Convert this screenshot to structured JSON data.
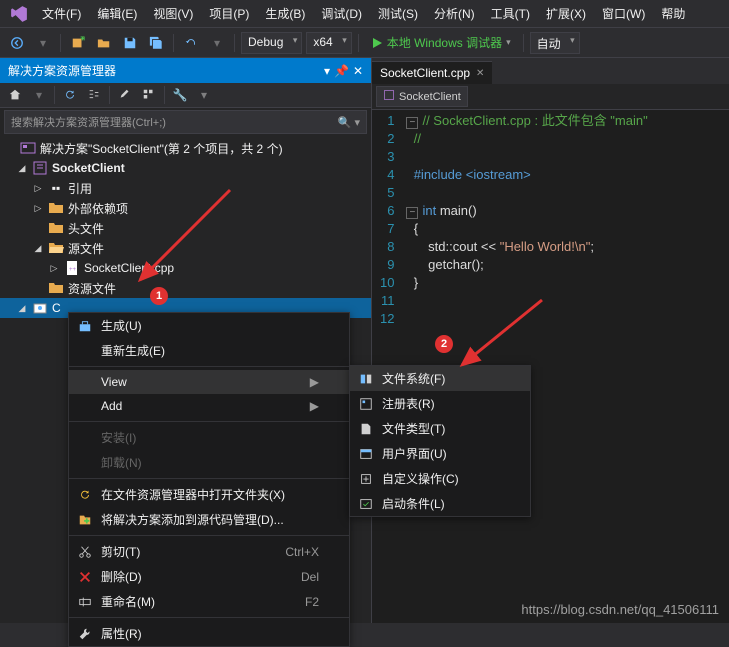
{
  "menubar": {
    "items": [
      "文件(F)",
      "编辑(E)",
      "视图(V)",
      "项目(P)",
      "生成(B)",
      "调试(D)",
      "测试(S)",
      "分析(N)",
      "工具(T)",
      "扩展(X)",
      "窗口(W)",
      "帮助"
    ]
  },
  "toolbar": {
    "config": "Debug",
    "platform": "x64",
    "run_label": "本地 Windows 调试器",
    "auto": "自动"
  },
  "solution_explorer": {
    "title": "解决方案资源管理器",
    "search_placeholder": "搜索解决方案资源管理器(Ctrl+;)",
    "solution_label": "解决方案\"SocketClient\"(第 2 个项目，共 2 个)",
    "project": "SocketClient",
    "nodes": {
      "references": "引用",
      "external": "外部依赖项",
      "headers": "头文件",
      "sources": "源文件",
      "source_file": "SocketClient.cpp",
      "resources": "资源文件"
    },
    "second_project_prefix": "C"
  },
  "editor": {
    "tab": "SocketClient.cpp",
    "nav": "SocketClient",
    "lines": {
      "l1": "// SocketClient.cpp : 此文件包含 \"main\"",
      "l2": "//",
      "l4": "#include <iostream>",
      "l6a": "int",
      "l6b": " main()",
      "l7": "{",
      "l8a": "    std::cout << ",
      "l8b": "\"Hello World!\\n\"",
      "l8c": ";",
      "l9": "    getchar();",
      "l10": "}"
    }
  },
  "context_menu": {
    "items": [
      {
        "icon": "build",
        "label": "生成(U)",
        "type": "item"
      },
      {
        "label": "重新生成(E)",
        "type": "item"
      },
      {
        "type": "sep"
      },
      {
        "label": "View",
        "type": "sub",
        "highlight": true
      },
      {
        "label": "Add",
        "type": "sub"
      },
      {
        "type": "sep"
      },
      {
        "label": "安装(I)",
        "type": "item",
        "disabled": true
      },
      {
        "label": "卸载(N)",
        "type": "item",
        "disabled": true
      },
      {
        "type": "sep"
      },
      {
        "icon": "refresh",
        "label": "在文件资源管理器中打开文件夹(X)",
        "type": "item"
      },
      {
        "icon": "scc",
        "label": "将解决方案添加到源代码管理(D)...",
        "type": "item"
      },
      {
        "type": "sep"
      },
      {
        "icon": "cut",
        "label": "剪切(T)",
        "shortcut": "Ctrl+X",
        "type": "item"
      },
      {
        "icon": "delete",
        "label": "删除(D)",
        "shortcut": "Del",
        "type": "item"
      },
      {
        "icon": "rename",
        "label": "重命名(M)",
        "shortcut": "F2",
        "type": "item"
      },
      {
        "type": "sep"
      },
      {
        "icon": "wrench",
        "label": "属性(R)",
        "type": "item"
      }
    ],
    "submenu": [
      {
        "icon": "fs",
        "label": "文件系统(F)",
        "highlight": true
      },
      {
        "icon": "reg",
        "label": "注册表(R)"
      },
      {
        "icon": "ft",
        "label": "文件类型(T)"
      },
      {
        "icon": "ui",
        "label": "用户界面(U)"
      },
      {
        "icon": "ca",
        "label": "自定义操作(C)"
      },
      {
        "icon": "lc",
        "label": "启动条件(L)"
      }
    ]
  },
  "badges": {
    "b1": "1",
    "b2": "2"
  },
  "watermark": "https://blog.csdn.net/qq_41506111"
}
